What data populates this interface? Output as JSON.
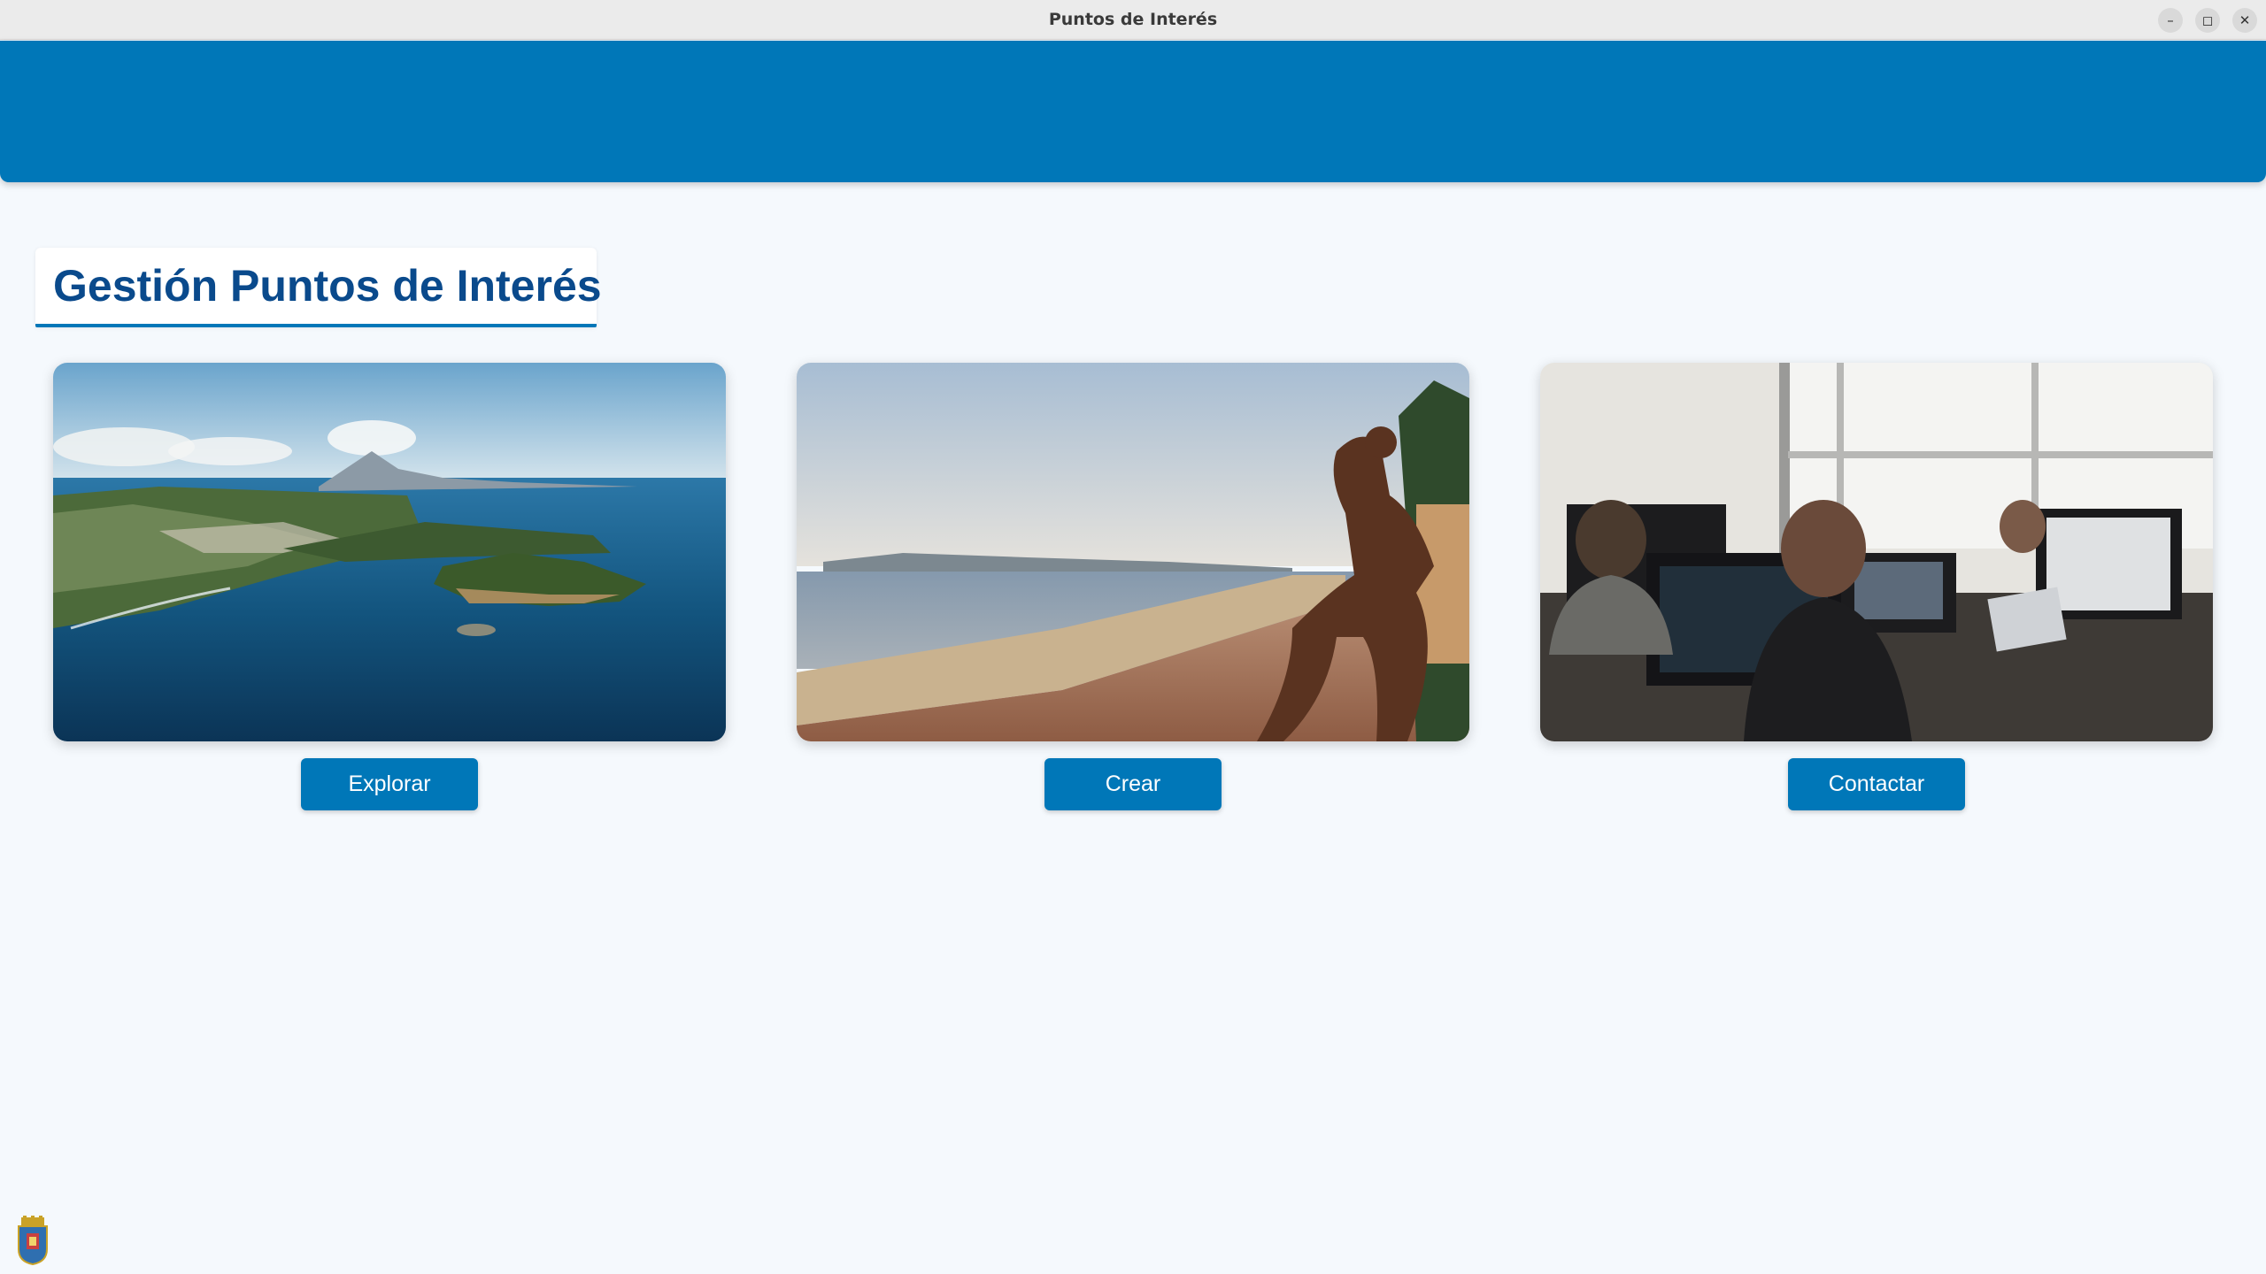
{
  "window": {
    "title": "Puntos de Interés",
    "controls": {
      "minimize": "–",
      "maximize": "◻",
      "close": "✕"
    }
  },
  "colors": {
    "accent": "#0077b8",
    "heading": "#0a4a8c",
    "background": "#f5f9fd"
  },
  "page": {
    "heading": "Gestión Puntos de Interés"
  },
  "cards": [
    {
      "image": "coastline-aerial-photo",
      "button_label": "Explorar"
    },
    {
      "image": "seafront-promenade-sculpture-photo",
      "button_label": "Crear"
    },
    {
      "image": "office-workers-computers-photo",
      "button_label": "Contactar"
    }
  ],
  "footer": {
    "logo": "town-crest-icon"
  }
}
